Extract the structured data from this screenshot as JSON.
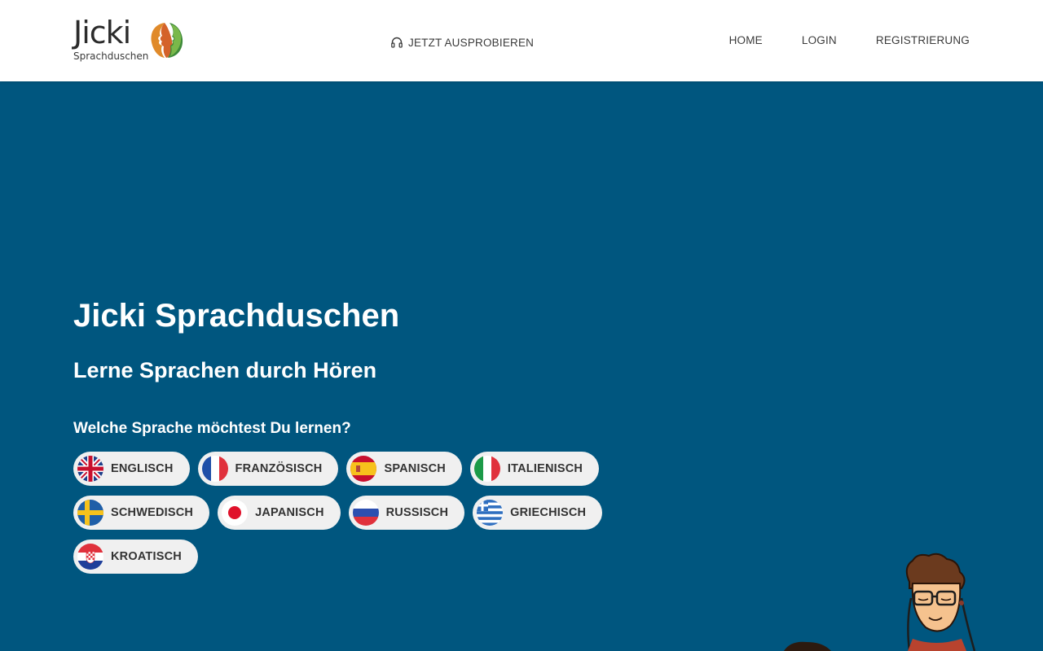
{
  "header": {
    "logo": {
      "word": "Jicki",
      "sub": "Sprachduschen"
    },
    "try_link": {
      "label": "JETZT AUSPROBIEREN",
      "icon": "headphones-icon"
    },
    "nav": [
      {
        "label": "HOME"
      },
      {
        "label": "LOGIN"
      },
      {
        "label": "REGISTRIERUNG"
      }
    ]
  },
  "hero": {
    "title": "Jicki Sprachduschen",
    "subtitle": "Lerne Sprachen durch Hören",
    "question": "Welche Sprache möchtest Du lernen?"
  },
  "languages": [
    {
      "label": "ENGLISCH",
      "flag": "uk-flag-icon"
    },
    {
      "label": "FRANZÖSISCH",
      "flag": "france-flag-icon"
    },
    {
      "label": "SPANISCH",
      "flag": "spain-flag-icon"
    },
    {
      "label": "ITALIENISCH",
      "flag": "italy-flag-icon"
    },
    {
      "label": "SCHWEDISCH",
      "flag": "sweden-flag-icon"
    },
    {
      "label": "JAPANISCH",
      "flag": "japan-flag-icon"
    },
    {
      "label": "RUSSISCH",
      "flag": "russia-flag-icon"
    },
    {
      "label": "GRIECHISCH",
      "flag": "greece-flag-icon"
    },
    {
      "label": "KROATISCH",
      "flag": "croatia-flag-icon"
    }
  ],
  "colors": {
    "background": "#00567f",
    "header": "#ffffff",
    "pill": "#f0f0f0",
    "text_dark": "#333333"
  }
}
